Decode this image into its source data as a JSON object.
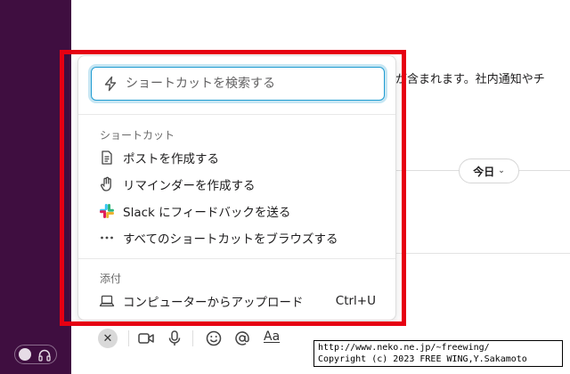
{
  "main": {
    "background_text": "が含まれます。社内通知やチ",
    "today_chip_label": "今日"
  },
  "popup": {
    "search": {
      "placeholder": "ショートカットを検索する",
      "value": ""
    },
    "shortcuts_section_label": "ショートカット",
    "shortcuts": [
      {
        "label": "ポストを作成する",
        "icon": "document-icon"
      },
      {
        "label": "リマインダーを作成する",
        "icon": "hand-icon"
      },
      {
        "label": "Slack にフィードバックを送る",
        "icon": "slack-logo-icon"
      },
      {
        "label": "すべてのショートカットをブラウズする",
        "icon": "more-dots-icon"
      }
    ],
    "attach_section_label": "添付",
    "attach_items": [
      {
        "label": "コンピューターからアップロード",
        "shortcut": "Ctrl+U",
        "icon": "laptop-icon"
      }
    ]
  },
  "composer": {
    "format_label": "Aa",
    "close_glyph": "✕"
  },
  "watermark": {
    "line1": "http://www.neko.ne.jp/~freewing/",
    "line2": "Copyright (c) 2023 FREE WING,Y.Sakamoto"
  },
  "colors": {
    "sidebar": "#3f0e40",
    "highlight_frame": "#e60012",
    "focus_ring": "#1d9bd1"
  }
}
